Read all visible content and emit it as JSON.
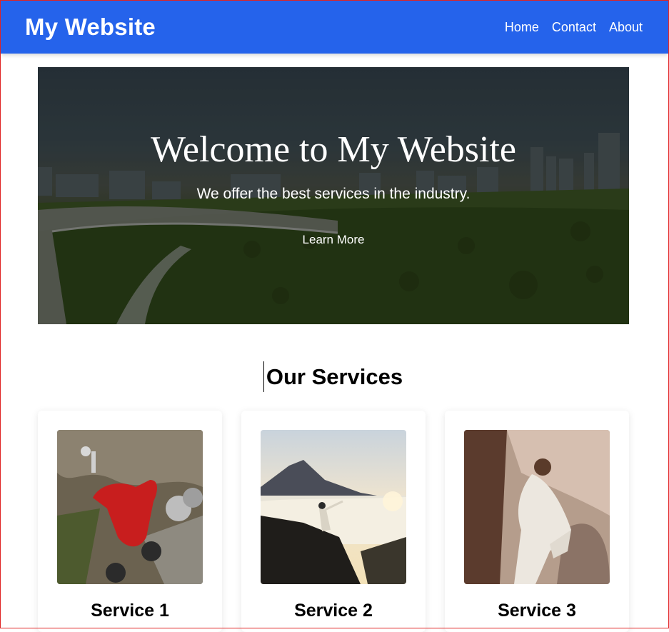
{
  "header": {
    "brand": "My Website",
    "nav": [
      "Home",
      "Contact",
      "About"
    ],
    "color": "#2563eb"
  },
  "hero": {
    "title": "Welcome to My Website",
    "subtitle": "We offer the best services in the industry.",
    "cta_label": "Learn More"
  },
  "services": {
    "title": "Our Services",
    "cards": [
      {
        "title": "Service 1",
        "image": "red-scooter-photo"
      },
      {
        "title": "Service 2",
        "image": "mountain-above-clouds-photo"
      },
      {
        "title": "Service 3",
        "image": "woman-white-dress-photo"
      }
    ]
  }
}
